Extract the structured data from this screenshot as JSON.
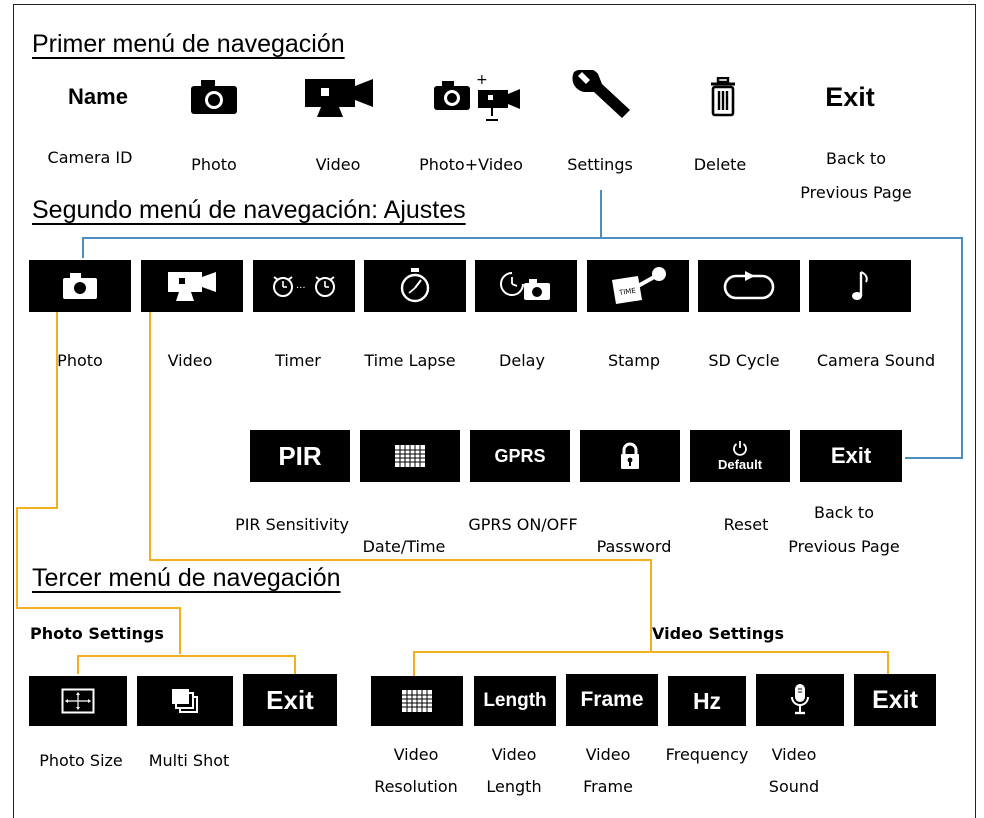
{
  "headings": {
    "first": "Primer menú de navegación",
    "second": "Segundo menú de navegación: Ajustes",
    "third": "Tercer menú de navegación"
  },
  "main_menu": [
    {
      "icon": "name-text",
      "icon_text": "Name",
      "label": "Camera ID"
    },
    {
      "icon": "camera-icon",
      "label": "Photo"
    },
    {
      "icon": "video-camera-icon",
      "label": "Video"
    },
    {
      "icon": "photo-video-icon",
      "label": "Photo+Video"
    },
    {
      "icon": "wrench-icon",
      "label": "Settings"
    },
    {
      "icon": "trash-icon",
      "label": "Delete"
    },
    {
      "icon": "exit-text",
      "icon_text": "Exit",
      "label_lines": [
        "Back to",
        "Previous Page"
      ]
    }
  ],
  "settings_row1": [
    {
      "icon": "camera-icon",
      "label": "Photo"
    },
    {
      "icon": "video-camera-icon",
      "label": "Video"
    },
    {
      "icon": "alarm-clocks-icon",
      "label": "Timer"
    },
    {
      "icon": "stopwatch-icon",
      "label": "Time Lapse"
    },
    {
      "icon": "delay-camera-icon",
      "label": "Delay"
    },
    {
      "icon": "stamp-icon",
      "label": "Stamp"
    },
    {
      "icon": "cycle-icon",
      "label": "SD Cycle"
    },
    {
      "icon": "music-note-icon",
      "label": "Camera Sound"
    }
  ],
  "settings_row2": [
    {
      "icon": "pir-text",
      "icon_text": "PIR",
      "label": "PIR Sensitivity"
    },
    {
      "icon": "calendar-grid-icon",
      "label": "Date/Time"
    },
    {
      "icon": "gprs-text",
      "icon_text": "GPRS",
      "label": "GPRS ON/OFF"
    },
    {
      "icon": "padlock-icon",
      "label": "Password"
    },
    {
      "icon": "power-default-icon",
      "icon_text": "Default",
      "label": "Reset"
    },
    {
      "icon": "exit-text",
      "icon_text": "Exit",
      "label_lines": [
        "Back to",
        "Previous Page"
      ]
    }
  ],
  "photo_settings": {
    "title": "Photo Settings",
    "items": [
      {
        "icon": "frame-resize-icon",
        "label": "Photo Size"
      },
      {
        "icon": "stacked-windows-icon",
        "label": "Multi Shot"
      },
      {
        "icon": "exit-text",
        "icon_text": "Exit"
      }
    ]
  },
  "video_settings": {
    "title": "Video Settings",
    "items": [
      {
        "icon": "resolution-grid-icon",
        "label_lines": [
          "Video",
          "Resolution"
        ]
      },
      {
        "icon": "length-text",
        "icon_text": "Length",
        "label_lines": [
          "Video",
          "Length"
        ]
      },
      {
        "icon": "frame-text",
        "icon_text": "Frame",
        "label_lines": [
          "Video",
          "Frame"
        ]
      },
      {
        "icon": "hz-text",
        "icon_text": "Hz",
        "label": "Frequency"
      },
      {
        "icon": "microphone-icon",
        "label_lines": [
          "Video",
          "Sound"
        ]
      },
      {
        "icon": "exit-text",
        "icon_text": "Exit"
      }
    ]
  },
  "colors": {
    "settings_link": "#4a8fc0",
    "photo_video_link": "#f2b01e",
    "box_fill": "#000000"
  }
}
